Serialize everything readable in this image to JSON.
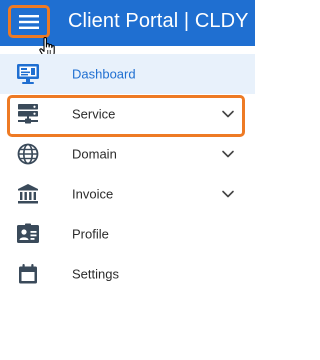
{
  "header": {
    "title": "Client Portal | CLDY",
    "menu_icon": "hamburger-menu-icon"
  },
  "colors": {
    "header_bg": "#1f6fd1",
    "highlight": "#ee7a24",
    "active_bg": "#e8f1fb",
    "active_text": "#1f6fd1",
    "icon": "#3a4a5a"
  },
  "nav": {
    "items": [
      {
        "label": "Dashboard",
        "icon": "monitor-icon",
        "active": true,
        "has_submenu": false
      },
      {
        "label": "Service",
        "icon": "server-icon",
        "active": false,
        "has_submenu": true,
        "highlighted": true
      },
      {
        "label": "Domain",
        "icon": "globe-icon",
        "active": false,
        "has_submenu": true
      },
      {
        "label": "Invoice",
        "icon": "bank-icon",
        "active": false,
        "has_submenu": true
      },
      {
        "label": "Profile",
        "icon": "id-card-icon",
        "active": false,
        "has_submenu": false
      },
      {
        "label": "Settings",
        "icon": "calendar-icon",
        "active": false,
        "has_submenu": false
      }
    ]
  }
}
